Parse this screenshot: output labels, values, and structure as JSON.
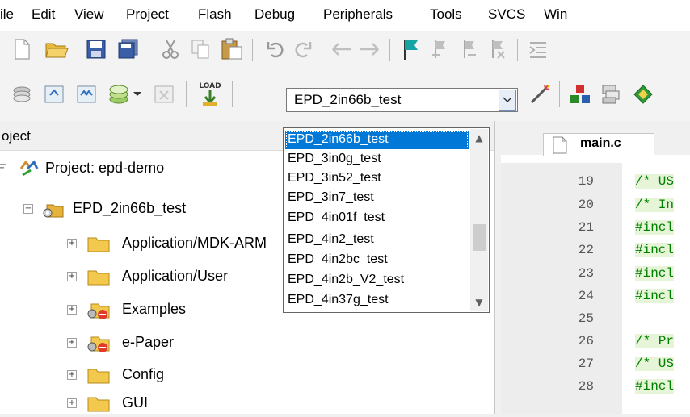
{
  "menubar": {
    "items": [
      "ile",
      "Edit",
      "View",
      "Project",
      "Flash",
      "Debug",
      "Peripherals",
      "Tools",
      "SVCS",
      "Win"
    ]
  },
  "target_combo": {
    "value": "EPD_2in66b_test",
    "options": [
      "EPD_2in66b_test",
      "EPD_3in0g_test",
      "EPD_3in52_test",
      "EPD_3in7_test",
      "EPD_4in01f_test",
      "EPD_4in2_test",
      "EPD_4in2bc_test",
      "EPD_4in2b_V2_test",
      "EPD_4in37g_test"
    ]
  },
  "toolbar": {
    "load_label": "LOAD"
  },
  "project_panel": {
    "title": "oject",
    "root": "Project: epd-demo",
    "target": "EPD_2in66b_test",
    "groups": [
      "Application/MDK-ARM",
      "Application/User",
      "Examples",
      "e-Paper",
      "Config",
      "GUI"
    ]
  },
  "editor": {
    "tab": "main.c",
    "lines": [
      {
        "num": "19",
        "code": "/* US"
      },
      {
        "num": "20",
        "code": "/* In"
      },
      {
        "num": "21",
        "code": "#incl"
      },
      {
        "num": "22",
        "code": "#incl"
      },
      {
        "num": "23",
        "code": "#incl"
      },
      {
        "num": "24",
        "code": "#incl"
      },
      {
        "num": "25",
        "code": ""
      },
      {
        "num": "26",
        "code": "/* Pr"
      },
      {
        "num": "27",
        "code": "/* US"
      },
      {
        "num": "28",
        "code": "#incl"
      }
    ]
  },
  "colors": {
    "selection": "#0078d7",
    "code_green": "#008000",
    "comment_bg": "#e6f4d7"
  }
}
